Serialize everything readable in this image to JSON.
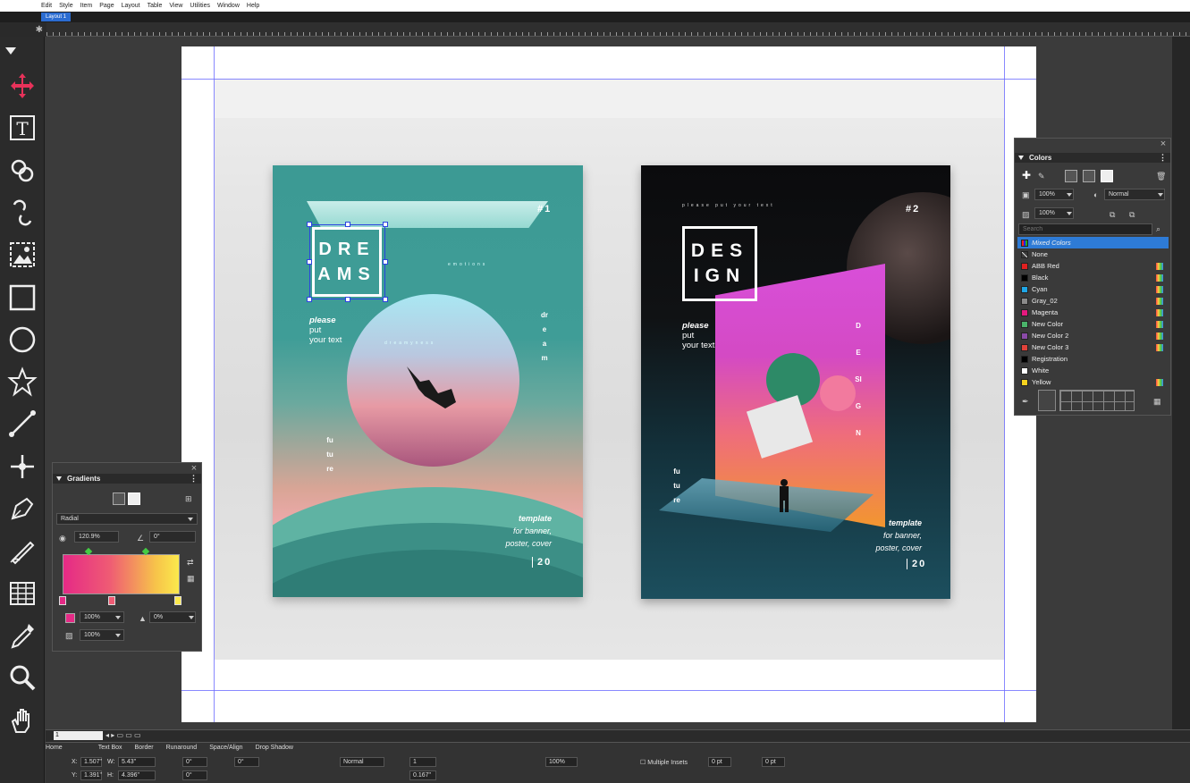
{
  "menu": [
    "Edit",
    "Style",
    "Item",
    "Page",
    "Layout",
    "Table",
    "View",
    "Utilities",
    "Window",
    "Help"
  ],
  "layout_tab": "Layout 1",
  "tools": [
    {
      "name": "item-move-icon"
    },
    {
      "name": "text-tool-icon"
    },
    {
      "name": "text-linking-icon"
    },
    {
      "name": "unlinking-icon"
    },
    {
      "name": "picture-content-icon"
    },
    {
      "name": "rectangle-box-icon"
    },
    {
      "name": "oval-box-icon"
    },
    {
      "name": "starburst-icon"
    },
    {
      "name": "line-tool-icon"
    },
    {
      "name": "point-tool-icon"
    },
    {
      "name": "pen-tool-icon"
    },
    {
      "name": "freehand-tool-icon"
    },
    {
      "name": "table-tool-icon"
    },
    {
      "name": "eyedropper-icon"
    },
    {
      "name": "zoom-icon"
    },
    {
      "name": "hand-icon"
    }
  ],
  "poster1": {
    "title_line1": "DRE",
    "title_line2": "AMS",
    "num": "#1",
    "please": "please",
    "put": "put",
    "your_text": "your text",
    "emotions": "emotions",
    "dreamy": "dreamyness",
    "vert_right": "dream",
    "vert_left": "future",
    "template": "template",
    "for_banner": "for banner,",
    "poster_cover": "poster, cover",
    "twenty": "20"
  },
  "poster2": {
    "top_text": "please put your text",
    "num": "#2",
    "title_line1": "DES",
    "title_line2": "IGN",
    "please": "please",
    "put": "put",
    "your_text": "your text",
    "vert_panel": "DESIGN",
    "vert_left": "future",
    "template": "template",
    "for_banner": "for banner,",
    "poster_cover": "poster, cover",
    "twenty": "20"
  },
  "gradients_panel": {
    "title": "Gradients",
    "type": "Radial",
    "scale": "120.9%",
    "angle": "0°",
    "opacity": "100%",
    "location": "0%",
    "tint": "100%",
    "stop_colors": [
      "#e52a86",
      "#ef5b74",
      "#fbe94c"
    ]
  },
  "colors_panel": {
    "title": "Colors",
    "shade": "100%",
    "blend": "Normal",
    "opacity": "100%",
    "search_placeholder": "Search",
    "items": [
      {
        "label": "Mixed Colors",
        "color": "#3a3a3a",
        "selected": true,
        "mark": false
      },
      {
        "label": "None",
        "color": "#3a3a3a",
        "selected": false,
        "mark": false
      },
      {
        "label": "ABB Red",
        "color": "#e02020",
        "selected": false,
        "mark": true
      },
      {
        "label": "Black",
        "color": "#000000",
        "selected": false,
        "mark": true
      },
      {
        "label": "Cyan",
        "color": "#1fa6e6",
        "selected": false,
        "mark": true
      },
      {
        "label": "Gray_02",
        "color": "#8a8a8a",
        "selected": false,
        "mark": true
      },
      {
        "label": "Magenta",
        "color": "#e5197f",
        "selected": false,
        "mark": true
      },
      {
        "label": "New Color",
        "color": "#4ab36a",
        "selected": false,
        "mark": true
      },
      {
        "label": "New Color 2",
        "color": "#8a4aa8",
        "selected": false,
        "mark": true
      },
      {
        "label": "New Color 3",
        "color": "#e0423a",
        "selected": false,
        "mark": true
      },
      {
        "label": "Registration",
        "color": "#000000",
        "selected": false,
        "mark": false
      },
      {
        "label": "White",
        "color": "#ffffff",
        "selected": false,
        "mark": false
      },
      {
        "label": "Yellow",
        "color": "#f5d21e",
        "selected": false,
        "mark": true
      }
    ]
  },
  "bottom": {
    "zoom": "1",
    "tabs": [
      "Home",
      "Text Box",
      "Border",
      "Runaround",
      "Space/Align",
      "Drop Shadow"
    ],
    "x_label": "X:",
    "x": "1.507\"",
    "y_label": "Y:",
    "y": "1.391\"",
    "w_label": "W:",
    "w": "5.43\"",
    "h_label": "H:",
    "h": "4.396\"",
    "angle1": "0°",
    "angle2": "0°",
    "skew": "0°",
    "cols": "1",
    "gutter": "0.167\"",
    "multiple_insets": "Multiple Insets",
    "inset": "0 pt",
    "inset2": "0 pt",
    "blend": "Normal",
    "opacity": "100%"
  }
}
